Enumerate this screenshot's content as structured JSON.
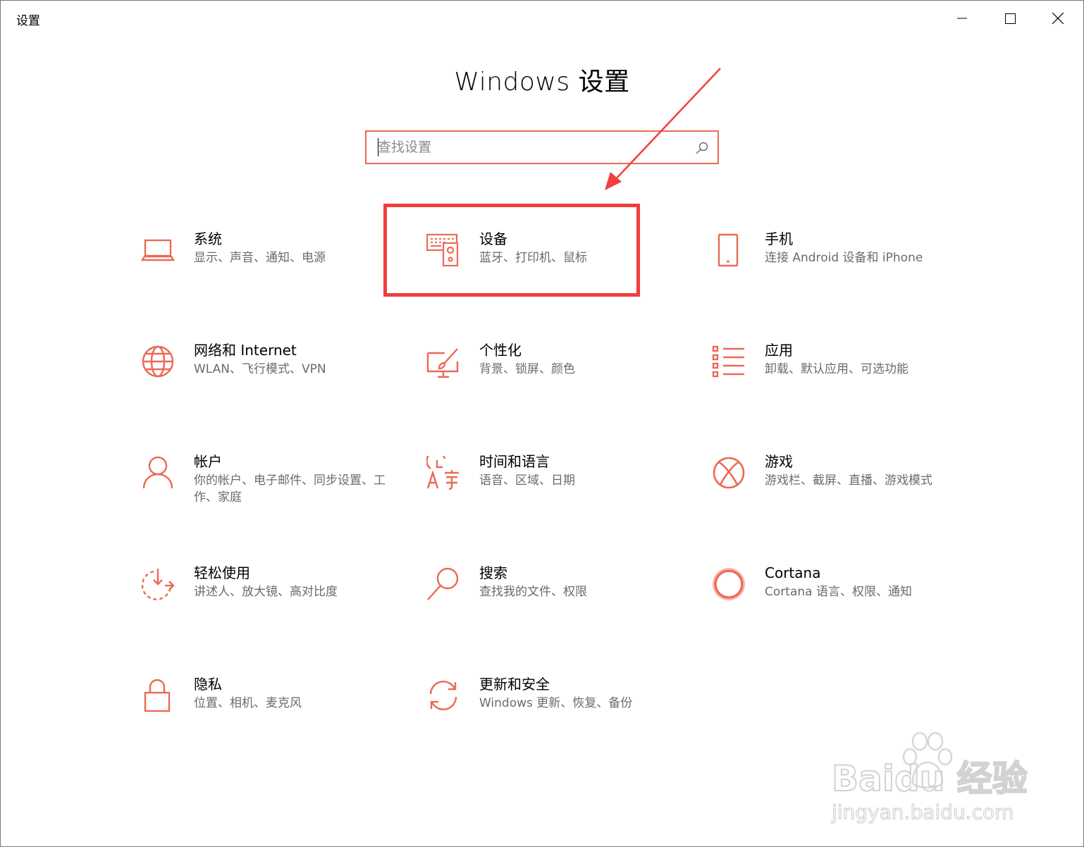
{
  "window": {
    "title": "设置"
  },
  "header": {
    "title": "Windows 设置"
  },
  "search": {
    "placeholder": "查找设置",
    "value": ""
  },
  "tiles": [
    {
      "icon": "laptop-icon",
      "title": "系统",
      "subtitle": "显示、声音、通知、电源"
    },
    {
      "icon": "keyboard-device-icon",
      "title": "设备",
      "subtitle": "蓝牙、打印机、鼠标"
    },
    {
      "icon": "phone-icon",
      "title": "手机",
      "subtitle": "连接 Android 设备和 iPhone"
    },
    {
      "icon": "globe-icon",
      "title": "网络和 Internet",
      "subtitle": "WLAN、飞行模式、VPN"
    },
    {
      "icon": "paint-brush-icon",
      "title": "个性化",
      "subtitle": "背景、锁屏、颜色"
    },
    {
      "icon": "apps-list-icon",
      "title": "应用",
      "subtitle": "卸载、默认应用、可选功能"
    },
    {
      "icon": "person-icon",
      "title": "帐户",
      "subtitle": "你的帐户、电子邮件、同步设置、工作、家庭"
    },
    {
      "icon": "time-language-icon",
      "title": "时间和语言",
      "subtitle": "语音、区域、日期"
    },
    {
      "icon": "xbox-icon",
      "title": "游戏",
      "subtitle": "游戏栏、截屏、直播、游戏模式"
    },
    {
      "icon": "ease-of-access-icon",
      "title": "轻松使用",
      "subtitle": "讲述人、放大镜、高对比度"
    },
    {
      "icon": "search-icon",
      "title": "搜索",
      "subtitle": "查找我的文件、权限"
    },
    {
      "icon": "cortana-icon",
      "title": "Cortana",
      "subtitle": "Cortana 语言、权限、通知"
    },
    {
      "icon": "lock-icon",
      "title": "隐私",
      "subtitle": "位置、相机、麦克风"
    },
    {
      "icon": "sync-icon",
      "title": "更新和安全",
      "subtitle": "Windows 更新、恢复、备份"
    }
  ],
  "watermark": {
    "brand": "Baidu 经验",
    "url": "jingyan.baidu.com"
  },
  "colors": {
    "accent": "#ea6a55",
    "annotation": "#f23e3e"
  }
}
